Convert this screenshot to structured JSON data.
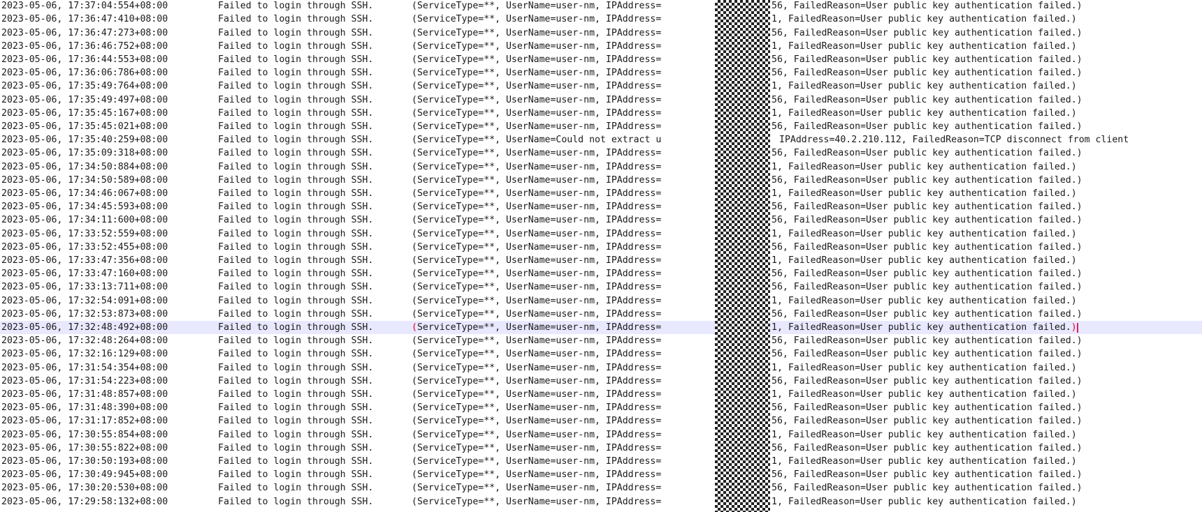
{
  "log": {
    "message": "Failed to login through SSH.",
    "details_prefix": "(ServiceType=**, UserName=user-nm, IPAddress=",
    "mask_icon": "pixelated-redaction",
    "current_line_index": 24,
    "colors": {
      "current_line_background": "#e8e8ff",
      "bracket_match": "#e0003a",
      "caret": "#e02060",
      "mask_dark": "#222222"
    },
    "entries": [
      {
        "timestamp": "2023-05-06, 17:37:04:554+08:00",
        "tail": "56, FailedReason=User public key authentication failed.)"
      },
      {
        "timestamp": "2023-05-06, 17:36:47:410+08:00",
        "tail": "1, FailedReason=User public key authentication failed.)"
      },
      {
        "timestamp": "2023-05-06, 17:36:47:273+08:00",
        "tail": "56, FailedReason=User public key authentication failed.)"
      },
      {
        "timestamp": "2023-05-06, 17:36:46:752+08:00",
        "tail": "1, FailedReason=User public key authentication failed.)"
      },
      {
        "timestamp": "2023-05-06, 17:36:44:553+08:00",
        "tail": "56, FailedReason=User public key authentication failed.)"
      },
      {
        "timestamp": "2023-05-06, 17:36:06:786+08:00",
        "tail": "56, FailedReason=User public key authentication failed.)"
      },
      {
        "timestamp": "2023-05-06, 17:35:49:764+08:00",
        "tail": "1, FailedReason=User public key authentication failed.)"
      },
      {
        "timestamp": "2023-05-06, 17:35:49:497+08:00",
        "tail": "56, FailedReason=User public key authentication failed.)"
      },
      {
        "timestamp": "2023-05-06, 17:35:45:167+08:00",
        "tail": "1, FailedReason=User public key authentication failed.)"
      },
      {
        "timestamp": "2023-05-06, 17:35:45:021+08:00",
        "tail": "56, FailedReason=User public key authentication failed.)"
      },
      {
        "timestamp": "2023-05-06, 17:35:40:259+08:00",
        "details": "(ServiceType=**, UserName=Could not extract u",
        "tail": "IPAddress=40.2.210.112, FailedReason=TCP disconnect from client"
      },
      {
        "timestamp": "2023-05-06, 17:35:09:318+08:00",
        "tail": "56, FailedReason=User public key authentication failed.)"
      },
      {
        "timestamp": "2023-05-06, 17:34:50:884+08:00",
        "tail": "1, FailedReason=User public key authentication failed.)"
      },
      {
        "timestamp": "2023-05-06, 17:34:50:589+08:00",
        "tail": "56, FailedReason=User public key authentication failed.)"
      },
      {
        "timestamp": "2023-05-06, 17:34:46:067+08:00",
        "tail": "1, FailedReason=User public key authentication failed.)"
      },
      {
        "timestamp": "2023-05-06, 17:34:45:593+08:00",
        "tail": "56, FailedReason=User public key authentication failed.)"
      },
      {
        "timestamp": "2023-05-06, 17:34:11:600+08:00",
        "tail": "56, FailedReason=User public key authentication failed.)"
      },
      {
        "timestamp": "2023-05-06, 17:33:52:559+08:00",
        "tail": "1, FailedReason=User public key authentication failed.)"
      },
      {
        "timestamp": "2023-05-06, 17:33:52:455+08:00",
        "tail": "56, FailedReason=User public key authentication failed.)"
      },
      {
        "timestamp": "2023-05-06, 17:33:47:356+08:00",
        "tail": "1, FailedReason=User public key authentication failed.)"
      },
      {
        "timestamp": "2023-05-06, 17:33:47:160+08:00",
        "tail": "56, FailedReason=User public key authentication failed.)"
      },
      {
        "timestamp": "2023-05-06, 17:33:13:711+08:00",
        "tail": "56, FailedReason=User public key authentication failed.)"
      },
      {
        "timestamp": "2023-05-06, 17:32:54:091+08:00",
        "tail": "1, FailedReason=User public key authentication failed.)"
      },
      {
        "timestamp": "2023-05-06, 17:32:53:873+08:00",
        "tail": "56, FailedReason=User public key authentication failed.)"
      },
      {
        "timestamp": "2023-05-06, 17:32:48:492+08:00",
        "tail": "1, FailedReason=User public key authentication failed.)"
      },
      {
        "timestamp": "2023-05-06, 17:32:48:264+08:00",
        "tail": "56, FailedReason=User public key authentication failed.)"
      },
      {
        "timestamp": "2023-05-06, 17:32:16:129+08:00",
        "tail": "56, FailedReason=User public key authentication failed.)"
      },
      {
        "timestamp": "2023-05-06, 17:31:54:354+08:00",
        "tail": "1, FailedReason=User public key authentication failed.)"
      },
      {
        "timestamp": "2023-05-06, 17:31:54:223+08:00",
        "tail": "56, FailedReason=User public key authentication failed.)"
      },
      {
        "timestamp": "2023-05-06, 17:31:48:857+08:00",
        "tail": "1, FailedReason=User public key authentication failed.)"
      },
      {
        "timestamp": "2023-05-06, 17:31:48:390+08:00",
        "tail": "56, FailedReason=User public key authentication failed.)"
      },
      {
        "timestamp": "2023-05-06, 17:31:17:852+08:00",
        "tail": "56, FailedReason=User public key authentication failed.)"
      },
      {
        "timestamp": "2023-05-06, 17:30:55:854+08:00",
        "tail": "1, FailedReason=User public key authentication failed.)"
      },
      {
        "timestamp": "2023-05-06, 17:30:55:822+08:00",
        "tail": "56, FailedReason=User public key authentication failed.)"
      },
      {
        "timestamp": "2023-05-06, 17:30:50:193+08:00",
        "tail": "1, FailedReason=User public key authentication failed.)"
      },
      {
        "timestamp": "2023-05-06, 17:30:49:945+08:00",
        "tail": "56, FailedReason=User public key authentication failed.)"
      },
      {
        "timestamp": "2023-05-06, 17:30:20:530+08:00",
        "tail": "56, FailedReason=User public key authentication failed.)"
      },
      {
        "timestamp": "2023-05-06, 17:29:58:132+08:00",
        "tail": "1, FailedReason=User public key authentication failed.)"
      }
    ]
  }
}
